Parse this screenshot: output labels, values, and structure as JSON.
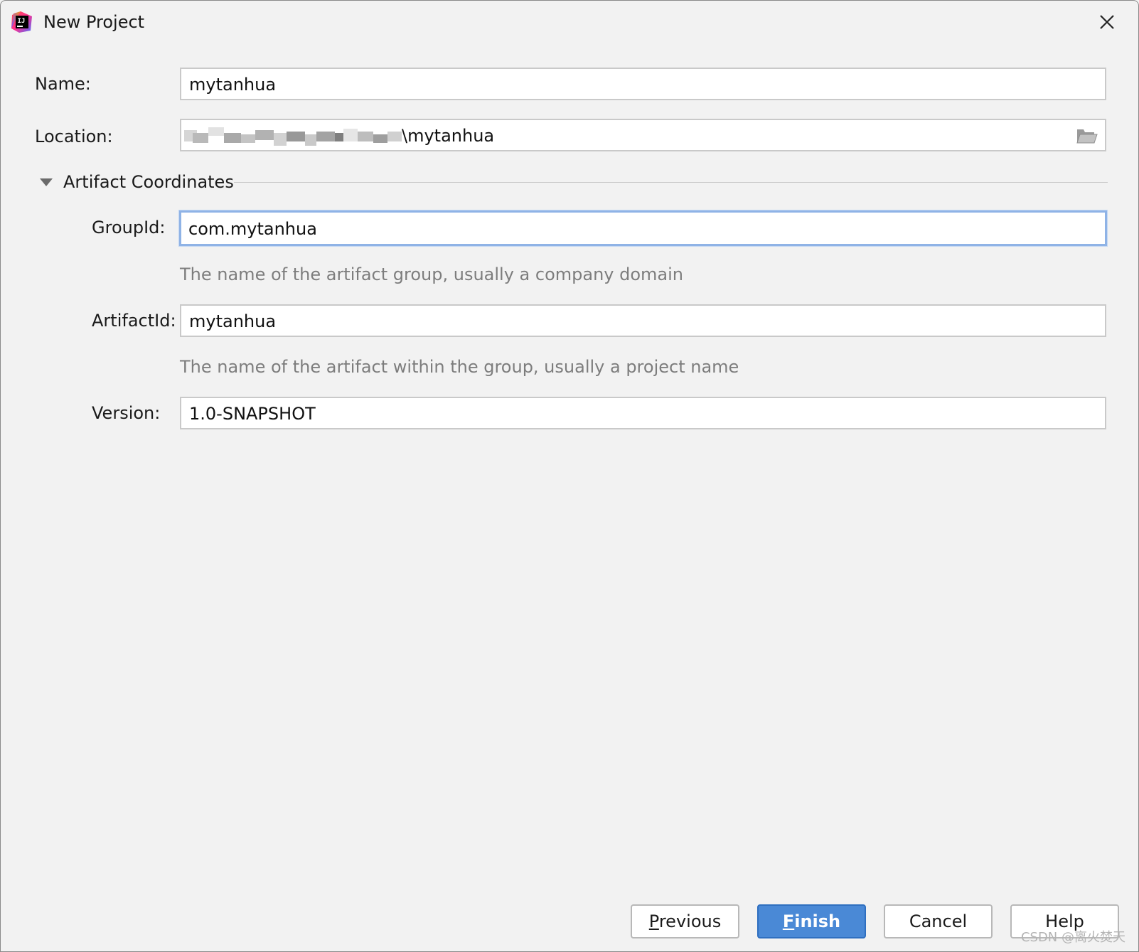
{
  "window": {
    "title": "New Project"
  },
  "form": {
    "name": {
      "label": "Name:",
      "value": "mytanhua"
    },
    "location": {
      "label": "Location:",
      "value": "\\mytanhua"
    },
    "section": {
      "title": "Artifact Coordinates",
      "expanded": true
    },
    "group_id": {
      "label": "GroupId:",
      "value": "com.mytanhua",
      "hint": "The name of the artifact group, usually a company domain"
    },
    "artifact_id": {
      "label": "ArtifactId:",
      "value": "mytanhua",
      "hint": "The name of the artifact within the group, usually a project name"
    },
    "version": {
      "label": "Version:",
      "value": "1.0-SNAPSHOT"
    }
  },
  "buttons": {
    "previous": {
      "mnemonic": "P",
      "rest": "revious"
    },
    "finish": {
      "mnemonic": "F",
      "rest": "inish"
    },
    "cancel": "Cancel",
    "help": "Help"
  },
  "watermark": "CSDN @离火焚天",
  "colors": {
    "background": "#f2f2f2",
    "primary_button": "#4a89d6",
    "focus_ring": "#8fb3e6",
    "hint_text": "#7d7d7d"
  },
  "icons": {
    "app": "intellij-idea-icon",
    "close": "close-icon",
    "collapse": "triangle-down-icon",
    "browse": "folder-open-icon"
  }
}
